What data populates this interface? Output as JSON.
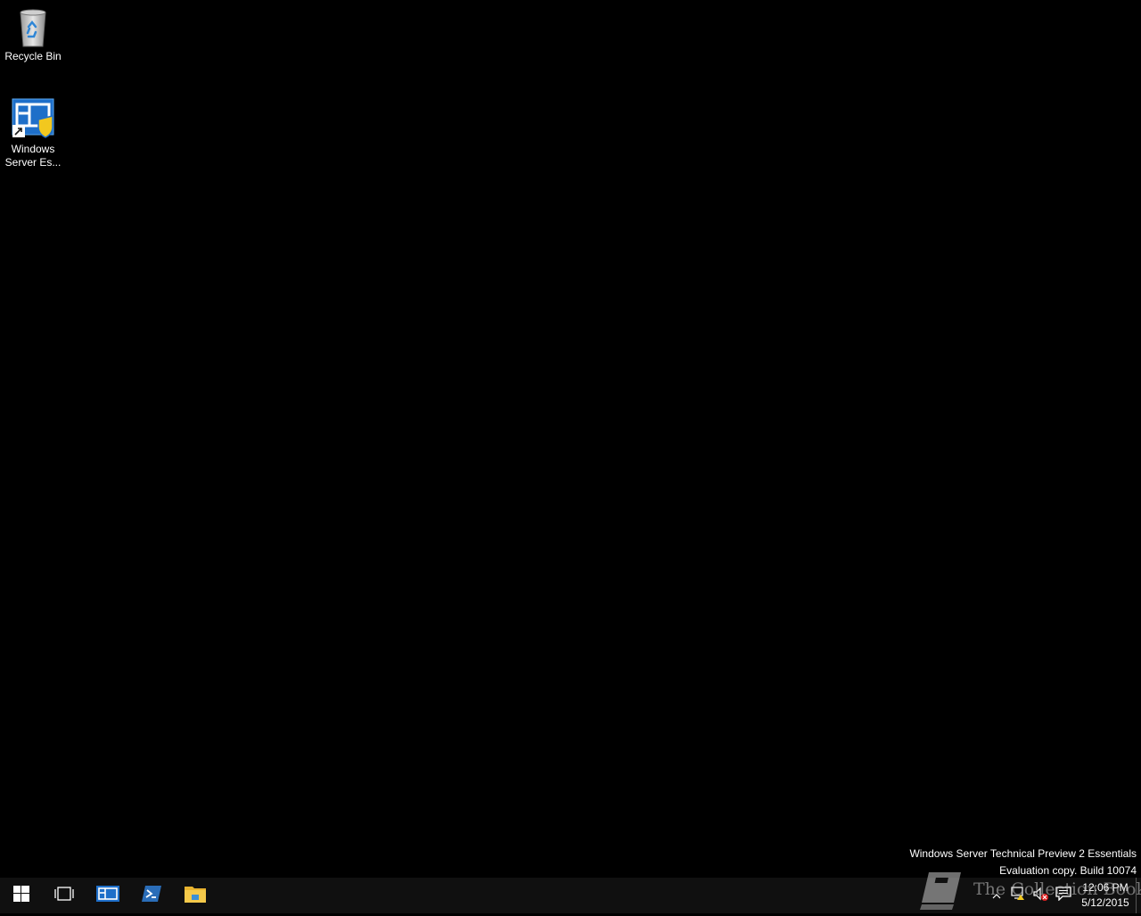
{
  "desktop": {
    "icons": [
      {
        "label": "Recycle Bin",
        "icon": "recycle-bin-icon"
      },
      {
        "label": "Windows\nServer Es...",
        "label_line1": "Windows",
        "label_line2": "Server Es...",
        "icon": "windows-server-essentials-dashboard-icon"
      }
    ],
    "watermark": {
      "line1": "Windows Server Technical Preview 2 Essentials",
      "line2": "Evaluation copy. Build 10074"
    }
  },
  "taskbar": {
    "start": {
      "icon": "windows-logo-icon"
    },
    "task_view": {
      "icon": "task-view-icon"
    },
    "pinned_apps": [
      {
        "icon": "essentials-dashboard-icon"
      },
      {
        "icon": "powershell-icon"
      },
      {
        "icon": "file-explorer-icon"
      }
    ],
    "tray": {
      "icons": [
        "show-hidden-icons-chevron",
        "network-warning-icon",
        "volume-muted-icon",
        "action-center-icon"
      ],
      "time": "12:06 PM",
      "date": "5/12/2015"
    }
  },
  "overlay_watermark": {
    "text": "The Collection Book",
    "icon": "book-icon"
  },
  "colors": {
    "desktop_bg": "#000000",
    "taskbar_bg": "#101010",
    "accent_blue": "#1e6fc9",
    "folder_yellow": "#f4c94a"
  }
}
